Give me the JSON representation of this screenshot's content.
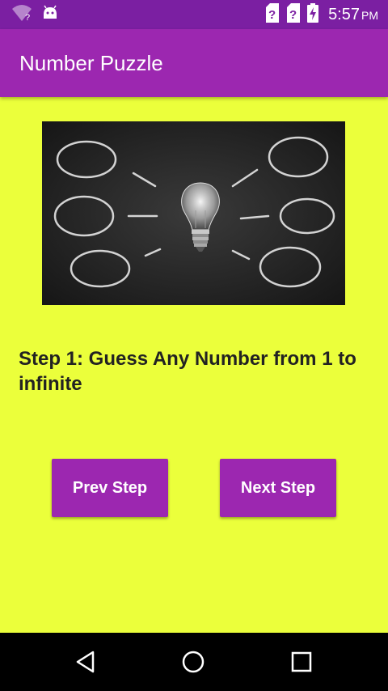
{
  "status_bar": {
    "time": "5:57",
    "ampm": "PM",
    "icons": [
      "wifi-unknown-icon",
      "android-icon",
      "sim-unknown-icon",
      "sim-unknown-icon",
      "battery-charging-icon"
    ]
  },
  "app_bar": {
    "title": "Number Puzzle"
  },
  "hero_image": {
    "description_icon": "lightbulb-chalkboard-image"
  },
  "main": {
    "step_text": "Step 1: Guess Any Number from 1 to infinite",
    "prev_button": "Prev Step",
    "next_button": "Next Step"
  },
  "nav_bar": {
    "icons": [
      "back-icon",
      "home-icon",
      "recent-apps-icon"
    ]
  },
  "colors": {
    "background": "#ebff3b",
    "app_bar": "#9c27b0",
    "status_bar": "#7b1fa2",
    "button": "#9c27b0"
  }
}
